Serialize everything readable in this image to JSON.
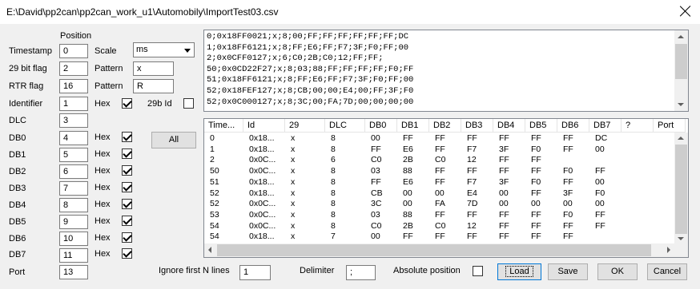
{
  "window": {
    "title": "E:\\David\\pp2can\\pp2can_work_u1\\Automobily\\ImportTest03.csv"
  },
  "config": {
    "position_header": "Position",
    "timestamp": {
      "label": "Timestamp",
      "position": "0"
    },
    "scale": {
      "label": "Scale",
      "selected": "ms"
    },
    "flag29": {
      "label": "29 bit flag",
      "position": "2"
    },
    "pattern1": {
      "label": "Pattern",
      "value": "x"
    },
    "rtr": {
      "label": "RTR flag",
      "position": "16"
    },
    "pattern2": {
      "label": "Pattern",
      "value": "R"
    },
    "identifier": {
      "label": "Identifier",
      "position": "1",
      "hex_label": "Hex",
      "hex_checked": true,
      "id29_label": "29b Id",
      "id29_checked": false
    },
    "dlc": {
      "label": "DLC",
      "position": "3"
    },
    "db": [
      {
        "label": "DB0",
        "position": "4",
        "hex_label": "Hex",
        "hex_checked": true
      },
      {
        "label": "DB1",
        "position": "5",
        "hex_label": "Hex",
        "hex_checked": true
      },
      {
        "label": "DB2",
        "position": "6",
        "hex_label": "Hex",
        "hex_checked": true
      },
      {
        "label": "DB3",
        "position": "7",
        "hex_label": "Hex",
        "hex_checked": true
      },
      {
        "label": "DB4",
        "position": "8",
        "hex_label": "Hex",
        "hex_checked": true
      },
      {
        "label": "DB5",
        "position": "9",
        "hex_label": "Hex",
        "hex_checked": true
      },
      {
        "label": "DB6",
        "position": "10",
        "hex_label": "Hex",
        "hex_checked": true
      },
      {
        "label": "DB7",
        "position": "11",
        "hex_label": "Hex",
        "hex_checked": true
      }
    ],
    "all_button": "All",
    "port": {
      "label": "Port",
      "position": "13"
    }
  },
  "raw_lines": [
    "0;0x18FF0021;x;8;00;FF;FF;FF;FF;FF;FF;DC",
    "1;0x18FF6121;x;8;FF;E6;FF;F7;3F;F0;FF;00",
    "2;0x0CFF0127;x;6;C0;2B;C0;12;FF;FF;",
    "50;0x0CD22F27;x;8;03;88;FF;FF;FF;FF;F0;FF",
    "51;0x18FF6121;x;8;FF;E6;FF;F7;3F;F0;FF;00",
    "52;0x18FEF127;x;8;CB;00;00;E4;00;FF;3F;F0",
    "52;0x0C000127;x;8;3C;00;FA;7D;00;00;00;00"
  ],
  "grid": {
    "headers": [
      "Time...",
      "Id",
      "29",
      "DLC",
      "DB0",
      "DB1",
      "DB2",
      "DB3",
      "DB4",
      "DB5",
      "DB6",
      "DB7",
      "?",
      "Port"
    ],
    "rows": [
      [
        "0",
        "0x18...",
        "x",
        "8",
        "00",
        "FF",
        "FF",
        "FF",
        "FF",
        "FF",
        "FF",
        "DC",
        "",
        ""
      ],
      [
        "1",
        "0x18...",
        "x",
        "8",
        "FF",
        "E6",
        "FF",
        "F7",
        "3F",
        "F0",
        "FF",
        "00",
        "",
        ""
      ],
      [
        "2",
        "0x0C...",
        "x",
        "6",
        "C0",
        "2B",
        "C0",
        "12",
        "FF",
        "FF",
        "",
        "",
        "",
        ""
      ],
      [
        "50",
        "0x0C...",
        "x",
        "8",
        "03",
        "88",
        "FF",
        "FF",
        "FF",
        "FF",
        "F0",
        "FF",
        "",
        ""
      ],
      [
        "51",
        "0x18...",
        "x",
        "8",
        "FF",
        "E6",
        "FF",
        "F7",
        "3F",
        "F0",
        "FF",
        "00",
        "",
        ""
      ],
      [
        "52",
        "0x18...",
        "x",
        "8",
        "CB",
        "00",
        "00",
        "E4",
        "00",
        "FF",
        "3F",
        "F0",
        "",
        ""
      ],
      [
        "52",
        "0x0C...",
        "x",
        "8",
        "3C",
        "00",
        "FA",
        "7D",
        "00",
        "00",
        "00",
        "00",
        "",
        ""
      ],
      [
        "53",
        "0x0C...",
        "x",
        "8",
        "03",
        "88",
        "FF",
        "FF",
        "FF",
        "FF",
        "F0",
        "FF",
        "",
        ""
      ],
      [
        "54",
        "0x0C...",
        "x",
        "8",
        "C0",
        "2B",
        "C0",
        "12",
        "FF",
        "FF",
        "FF",
        "FF",
        "",
        ""
      ],
      [
        "54",
        "0x18...",
        "x",
        "7",
        "00",
        "FF",
        "FF",
        "FF",
        "FF",
        "FF",
        "FF",
        "",
        "",
        ""
      ]
    ]
  },
  "bottom": {
    "ignore_label": "Ignore first N lines",
    "ignore_value": "1",
    "delimiter_label": "Delimiter",
    "delimiter_value": ";",
    "absolute_label": "Absolute position",
    "absolute_checked": false,
    "load": "Load",
    "save": "Save",
    "ok": "OK",
    "cancel": "Cancel"
  }
}
